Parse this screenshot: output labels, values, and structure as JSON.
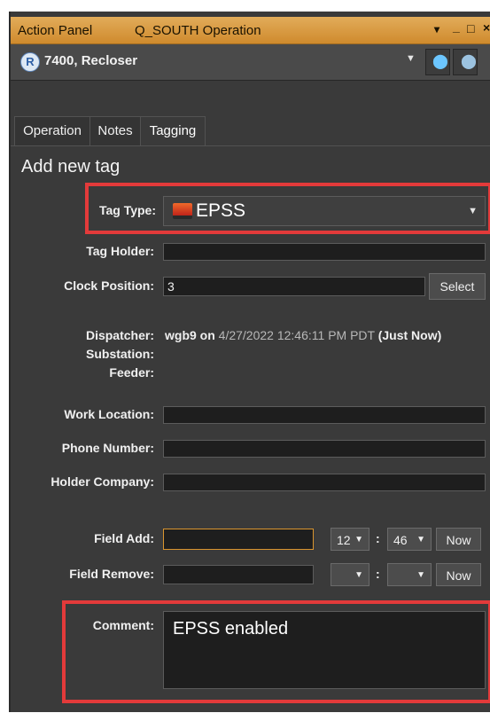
{
  "window": {
    "panel_title": "Action Panel",
    "context_title": "Q_SOUTH  Operation",
    "controls": {
      "dropdown": "▾",
      "minimize": "_",
      "restore": "□",
      "close": "×"
    }
  },
  "device": {
    "badge_letter": "R",
    "name": "7400, Recloser"
  },
  "tabs": [
    {
      "label": "Operation"
    },
    {
      "label": "Notes"
    },
    {
      "label": "Tagging"
    }
  ],
  "form": {
    "heading": "Add new tag",
    "tag_type": {
      "label": "Tag Type:",
      "value": "EPSS"
    },
    "tag_holder": {
      "label": "Tag Holder:",
      "value": ""
    },
    "clock_position": {
      "label": "Clock Position:",
      "value": "3",
      "button": "Select"
    },
    "dispatcher": {
      "label": "Dispatcher:",
      "user": "wgb9",
      "on_word": "on",
      "datetime": "4/27/2022 12:46:11 PM PDT",
      "relative": "(Just Now)"
    },
    "substation": {
      "label": "Substation:"
    },
    "feeder": {
      "label": "Feeder:"
    },
    "work_location": {
      "label": "Work Location:",
      "value": ""
    },
    "phone_number": {
      "label": "Phone Number:",
      "value": ""
    },
    "holder_company": {
      "label": "Holder Company:",
      "value": ""
    },
    "field_add": {
      "label": "Field Add:",
      "value": "",
      "hour": "12",
      "minute": "46",
      "separator": ":",
      "now_button": "Now"
    },
    "field_remove": {
      "label": "Field Remove:",
      "value": "",
      "hour": "",
      "minute": "",
      "separator": ":",
      "now_button": "Now"
    },
    "comment": {
      "label": "Comment:",
      "value": "EPSS enabled"
    }
  },
  "colors": {
    "titlebar": "#d9952f",
    "panel_bg": "#3a3a3a",
    "highlight_box": "#e33a3a",
    "focus_border": "#d9952f",
    "pin_icon": "#6cc6ff"
  }
}
